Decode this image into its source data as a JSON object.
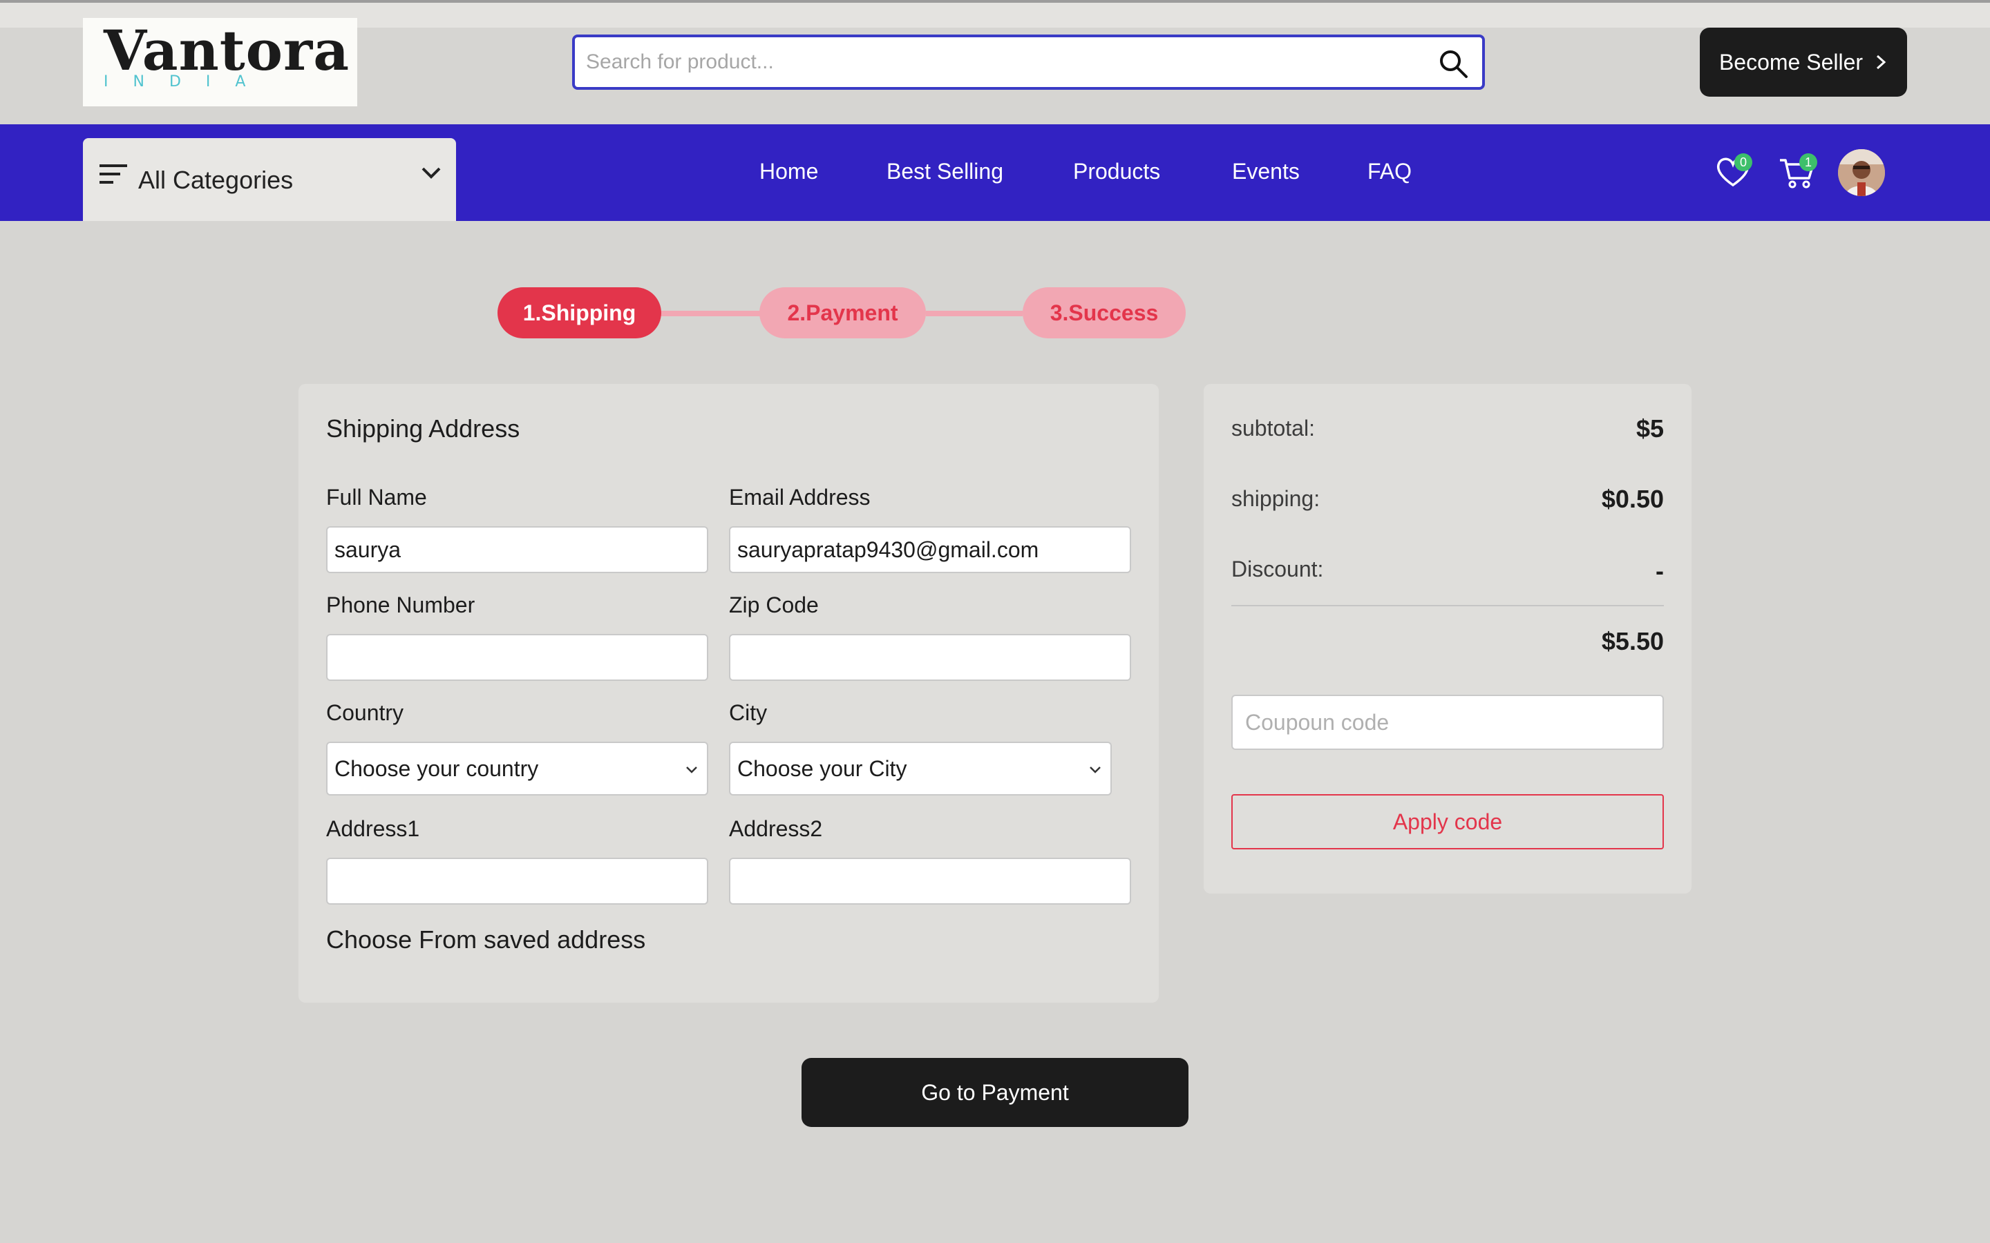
{
  "header": {
    "logo_text": "Vantora",
    "logo_subtext": "INDIA",
    "search_placeholder": "Search for product...",
    "search_icon": "search-icon",
    "seller_button": "Become Seller"
  },
  "navbar": {
    "categories_label": "All Categories",
    "links": [
      "Home",
      "Best Selling",
      "Products",
      "Events",
      "FAQ"
    ],
    "wishlist_count": "0",
    "cart_count": "1",
    "accent_color": "#3222c2"
  },
  "checkout_steps": [
    {
      "label": "1.Shipping",
      "state": "active"
    },
    {
      "label": "2.Payment",
      "state": "pending"
    },
    {
      "label": "3.Success",
      "state": "pending"
    }
  ],
  "shipping_form": {
    "title": "Shipping Address",
    "full_name": {
      "label": "Full Name",
      "value": "saurya"
    },
    "email": {
      "label": "Email Address",
      "value": "sauryapratap9430@gmail.com"
    },
    "phone": {
      "label": "Phone Number",
      "value": ""
    },
    "zip": {
      "label": "Zip Code",
      "value": ""
    },
    "country": {
      "label": "Country",
      "selected": "Choose your country"
    },
    "city": {
      "label": "City",
      "selected": "Choose your City"
    },
    "address1": {
      "label": "Address1",
      "value": ""
    },
    "address2": {
      "label": "Address2",
      "value": ""
    },
    "saved_address_link": "Choose From saved address"
  },
  "order_summary": {
    "subtotal_label": "subtotal:",
    "subtotal_value": "$5",
    "shipping_label": "shipping:",
    "shipping_value": "$0.50",
    "discount_label": "Discount:",
    "discount_value": "-",
    "total_value": "$5.50",
    "coupon_placeholder": "Coupoun code",
    "apply_button": "Apply code"
  },
  "go_to_payment_button": "Go to Payment",
  "colors": {
    "primary": "#3222c2",
    "step_active": "#e3354b",
    "step_pending": "#f2a7b3",
    "button_dark": "#1c1c1c"
  }
}
